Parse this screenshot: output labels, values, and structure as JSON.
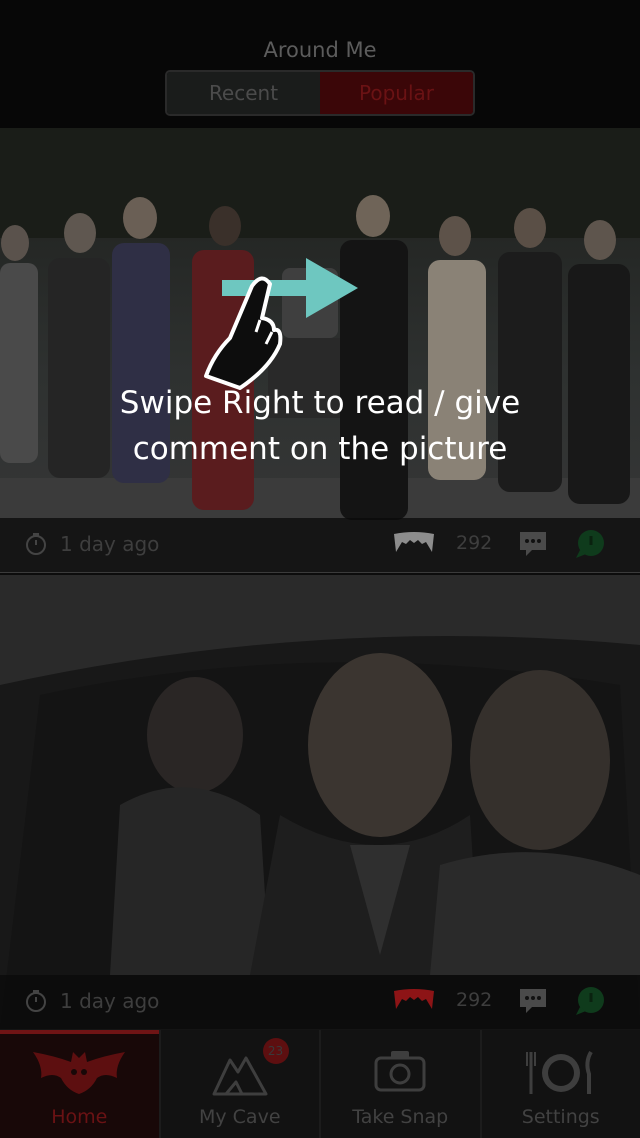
{
  "header": {
    "title": "Around Me",
    "tabs": [
      {
        "label": "Recent",
        "selected": false
      },
      {
        "label": "Popular",
        "selected": true
      }
    ]
  },
  "posts": [
    {
      "time": "1 day ago",
      "likes": "292",
      "fang_color": "#8d8d8d",
      "image": "group of women standing on a red carpet"
    },
    {
      "time": "1 day ago",
      "likes": "292",
      "fang_color": "#8d1416",
      "image": "smiling couple in the back seat of a car"
    }
  ],
  "hint": {
    "line1": "Swipe Right to read / give",
    "line2": "comment on the picture",
    "arrow_color": "#6ec7c0"
  },
  "tabbar": {
    "items": [
      {
        "label": "Home",
        "icon": "bat-icon",
        "active": true
      },
      {
        "label": "My Cave",
        "icon": "mountain-icon",
        "badge": "23"
      },
      {
        "label": "Take Snap",
        "icon": "camera-icon"
      },
      {
        "label": "Settings",
        "icon": "plate-cutlery-icon"
      }
    ]
  },
  "colors": {
    "accent": "#e0282b",
    "green": "#2e8f44"
  }
}
